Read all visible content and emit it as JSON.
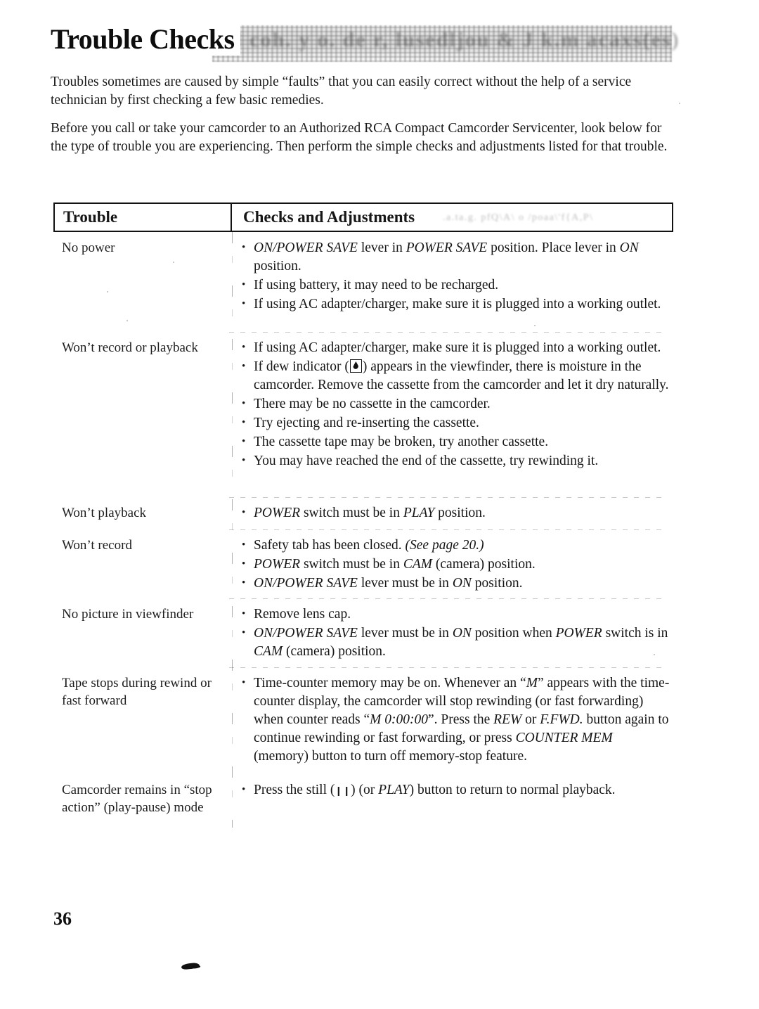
{
  "document": {
    "title": "Trouble Checks",
    "ghost_overlay_top": "scanner ghost band",
    "page_number": "36"
  },
  "intro": {
    "paragraph_1": "Troubles sometimes are caused by simple “faults” that you can easily correct without the help of a service technician by first checking a few basic remedies.",
    "paragraph_2": "Before you call or take your camcorder to an Authorized RCA Compact Camcorder Servicenter, look below for the type of trouble you are experiencing. Then perform the simple checks and adjustments listed for that trouble."
  },
  "table": {
    "headers": {
      "trouble": "Trouble",
      "checks": "Checks and Adjustments"
    },
    "rows": [
      {
        "trouble": "No power",
        "items": [
          "ON/POWER SAVE lever in POWER SAVE position.  Place lever in ON position.",
          "If using battery, it may need to be recharged.",
          "If using AC adapter/charger, make sure it is plugged into a working outlet."
        ]
      },
      {
        "trouble": "Won’t record or playback",
        "items": [
          "If using AC adapter/charger, make sure it is plugged into a working outlet.",
          "If dew indicator (□) appears in the viewfinder, there is moisture in the camcorder.  Remove the cassette from the camcorder and let it dry naturally.",
          "There may be no cassette in the camcorder.",
          "Try ejecting and re-inserting the cassette.",
          "The cassette tape may be broken, try another cassette.",
          "You may have reached the end of the cassette, try rewinding it."
        ]
      },
      {
        "trouble": "Won’t playback",
        "items": [
          "POWER switch must be in PLAY position."
        ]
      },
      {
        "trouble": "Won’t record",
        "items": [
          "Safety tab has been closed.  (See page 20.)",
          "POWER switch must be in CAM (camera) position.",
          "ON/POWER SAVE lever must be in ON position."
        ]
      },
      {
        "trouble": "No picture in viewfinder",
        "items": [
          "Remove lens cap.",
          "ON/POWER SAVE lever must be in ON position when POWER switch is in CAM (camera) position."
        ]
      },
      {
        "trouble": "Tape stops during rewind or fast forward",
        "items": [
          "Time-counter memory may be on. Whenever an “M” appears with the time-counter display, the camcorder will stop rewinding (or fast forwarding) when counter reads “M 0:00:00”.  Press the REW or F.FWD. button again to continue rewinding or fast forwarding, or press COUNTER MEM (memory) button to turn off memory-stop feature."
        ]
      },
      {
        "trouble": "Camcorder remains in “stop action” (play-pause) mode",
        "items": [
          "Press the still (❙❙) (or PLAY) button to return to normal playback."
        ]
      }
    ]
  },
  "row_fragments": {
    "r1_b1_a": "ON/POWER SAVE",
    "r1_b1_b": " lever in ",
    "r1_b1_c": "POWER SAVE",
    "r1_b1_d": " position.  Place lever in ",
    "r1_b1_e": "ON",
    "r1_b1_f": " position.",
    "r1_b2": "If using battery, it may need to be recharged.",
    "r1_b3": "If using AC adapter/charger, make sure it is plugged into a working outlet.",
    "r2_b1": "If using AC adapter/charger, make sure it is plugged into a working outlet.",
    "r2_b2_a": "If dew indicator (",
    "r2_b2_b": ") appears in the viewfinder, there is moisture in the camcorder.  Remove the cassette from the camcorder and let it dry naturally.",
    "r2_b3": "There may be no cassette in the camcorder.",
    "r2_b4": "Try ejecting and re-inserting the cassette.",
    "r2_b5": "The cassette tape may be broken, try another cassette.",
    "r2_b6": "You may have reached the end of the cassette, try rewinding it.",
    "r3_b1_a": "POWER",
    "r3_b1_b": " switch must be in ",
    "r3_b1_c": "PLAY",
    "r3_b1_d": " position.",
    "r4_b1_a": "Safety tab has been closed.  ",
    "r4_b1_b": "(See page 20.)",
    "r4_b2_a": "POWER",
    "r4_b2_b": " switch must be in ",
    "r4_b2_c": "CAM",
    "r4_b2_d": " (camera) position.",
    "r4_b3_a": "ON/POWER SAVE",
    "r4_b3_b": " lever must be in ",
    "r4_b3_c": "ON",
    "r4_b3_d": " position.",
    "r5_b1": "Remove lens cap.",
    "r5_b2_a": "ON/POWER SAVE",
    "r5_b2_b": " lever must be in ",
    "r5_b2_c": "ON",
    "r5_b2_d": " position when ",
    "r5_b2_e": "POWER",
    "r5_b2_f": " switch is in ",
    "r5_b2_g": "CAM",
    "r5_b2_h": " (camera) position.",
    "r6_b1_a": "Time-counter memory may be on. Whenever an “",
    "r6_b1_b": "M",
    "r6_b1_c": "” appears with the time-counter display, the camcorder will stop rewinding (or fast forwarding) when counter reads “",
    "r6_b1_d": "M 0:00:00",
    "r6_b1_e": "”.  Press the ",
    "r6_b1_f": "REW",
    "r6_b1_g": " or ",
    "r6_b1_h": "F.FWD.",
    "r6_b1_i": " button again to continue rewinding or fast forwarding, or press ",
    "r6_b1_j": "COUNTER MEM",
    "r6_b1_k": " (memory) button to turn off memory-stop feature.",
    "r7_b1_a": "Press the still (",
    "r7_b1_b": "❙❙",
    "r7_b1_c": ") (or ",
    "r7_b1_d": "PLAY",
    "r7_b1_e": ") button to return to normal playback."
  },
  "trouble_labels": {
    "t1": "No power",
    "t2": "Won’t record or playback",
    "t3": "Won’t playback",
    "t4": "Won’t record",
    "t5": "No picture in viewfinder",
    "t6": "Tape stops during rewind or fast forward",
    "t7": "Camcorder remains in “stop action” (play-pause) mode"
  },
  "colors": {
    "page_background": "#ffffff",
    "text": "#161616",
    "rule": "#111111"
  }
}
